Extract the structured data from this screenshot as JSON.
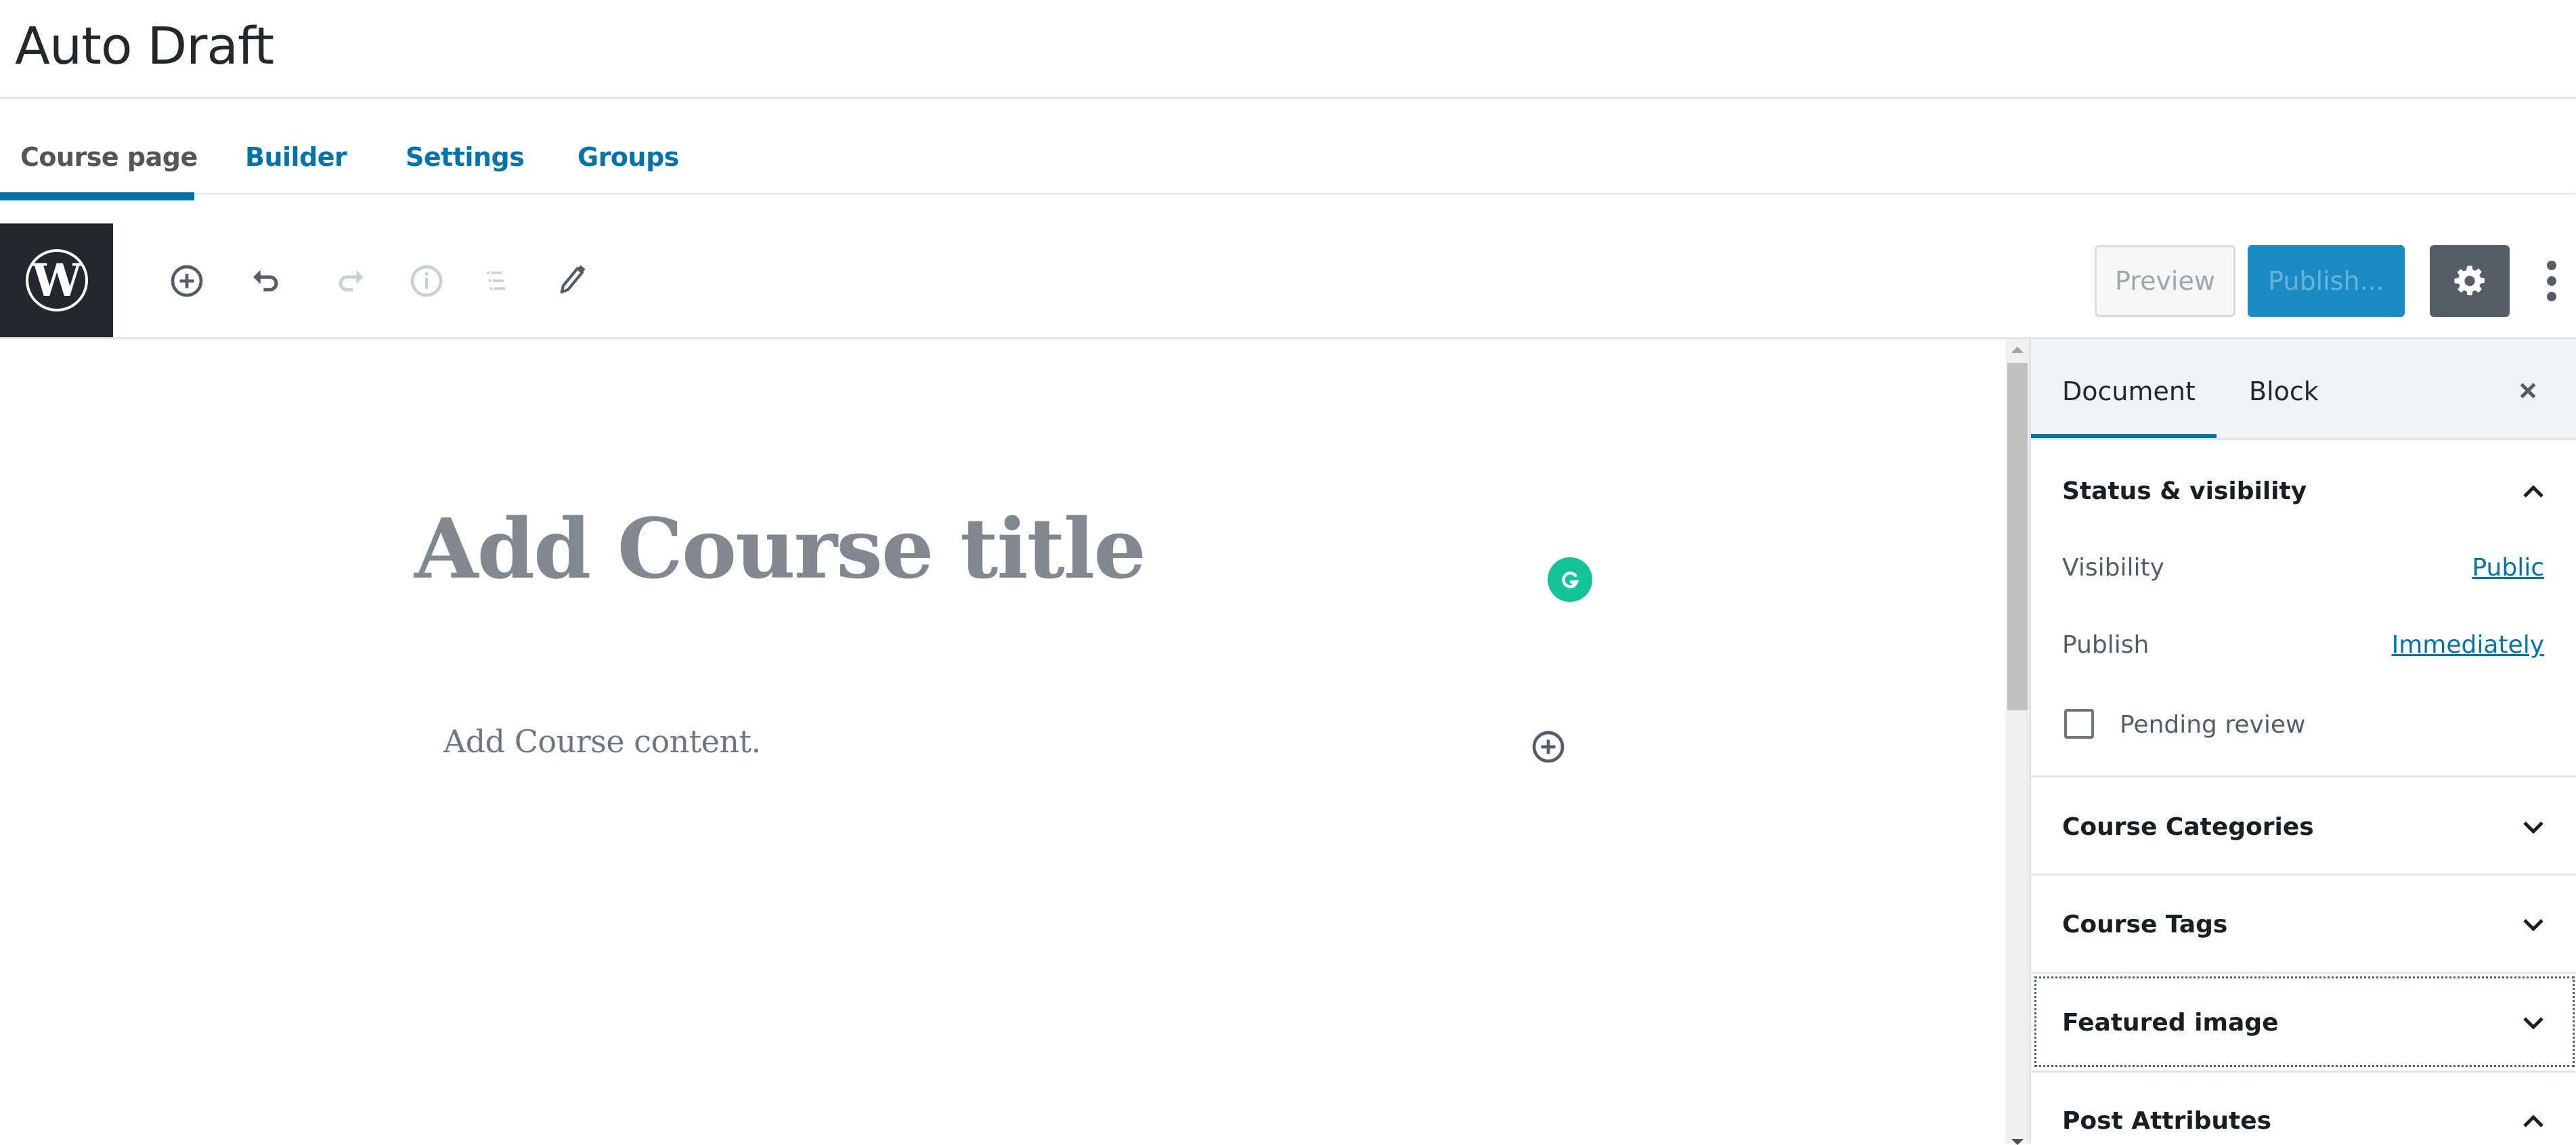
{
  "page": {
    "title": "Auto Draft"
  },
  "course_tabs": [
    {
      "label": "Course page",
      "active": true
    },
    {
      "label": "Builder",
      "active": false
    },
    {
      "label": "Settings",
      "active": false
    },
    {
      "label": "Groups",
      "active": false
    }
  ],
  "toolbar": {
    "logo": "wordpress-logo",
    "icons": [
      {
        "name": "add-block-icon",
        "enabled": true
      },
      {
        "name": "undo-icon",
        "enabled": true
      },
      {
        "name": "redo-icon",
        "enabled": false
      },
      {
        "name": "info-icon",
        "enabled": false
      },
      {
        "name": "block-navigation-icon",
        "enabled": false
      },
      {
        "name": "edit-mode-icon",
        "enabled": true
      }
    ],
    "preview_label": "Preview",
    "publish_label": "Publish...",
    "settings_icon": "gear-icon",
    "more_icon": "vertical-ellipsis-icon"
  },
  "editor": {
    "title_placeholder": "Add Course title",
    "content_placeholder": "Add Course content.",
    "grammarly_icon": "grammarly-icon"
  },
  "sidebar": {
    "tabs": [
      {
        "label": "Document",
        "active": true
      },
      {
        "label": "Block",
        "active": false
      }
    ],
    "close_icon": "close-icon",
    "panels": [
      {
        "title": "Status & visibility",
        "expanded": true,
        "rows": [
          {
            "label": "Visibility",
            "value": "Public"
          },
          {
            "label": "Publish",
            "value": "Immediately"
          }
        ],
        "checkbox": {
          "label": "Pending review",
          "checked": false
        }
      },
      {
        "title": "Course Categories",
        "expanded": false
      },
      {
        "title": "Course Tags",
        "expanded": false
      },
      {
        "title": "Featured image",
        "expanded": false,
        "focused": true
      },
      {
        "title": "Post Attributes",
        "expanded": true
      }
    ]
  },
  "colors": {
    "accent": "#0073aa",
    "publish_button": "#1b8bc3",
    "dark_toolbar": "#23282d",
    "settings_button": "#555d66",
    "grammarly": "#15c39a",
    "placeholder_text": "#818890"
  }
}
